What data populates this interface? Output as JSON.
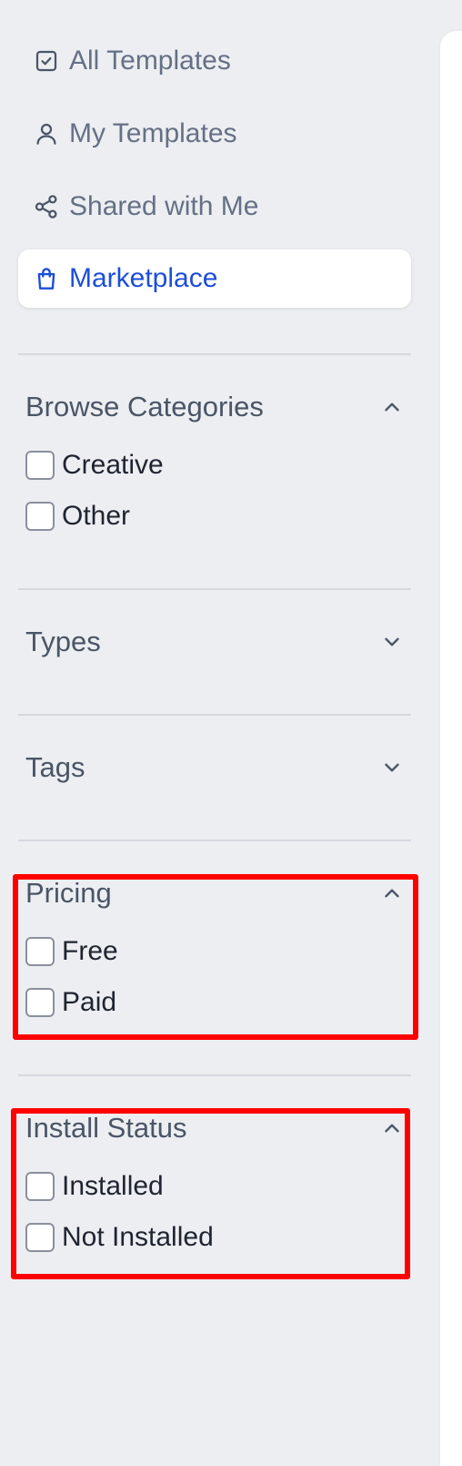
{
  "nav": {
    "all_templates": "All Templates",
    "my_templates": "My Templates",
    "shared_with_me": "Shared with Me",
    "marketplace": "Marketplace"
  },
  "filters": {
    "browse_categories": {
      "title": "Browse Categories",
      "expanded": true,
      "options": [
        "Creative",
        "Other"
      ]
    },
    "types": {
      "title": "Types",
      "expanded": false
    },
    "tags": {
      "title": "Tags",
      "expanded": false
    },
    "pricing": {
      "title": "Pricing",
      "expanded": true,
      "options": [
        "Free",
        "Paid"
      ]
    },
    "install_status": {
      "title": "Install Status",
      "expanded": true,
      "options": [
        "Installed",
        "Not Installed"
      ]
    }
  },
  "colors": {
    "background": "#eceef2",
    "accent": "#1d4ed8",
    "highlight": "#ff0000"
  }
}
